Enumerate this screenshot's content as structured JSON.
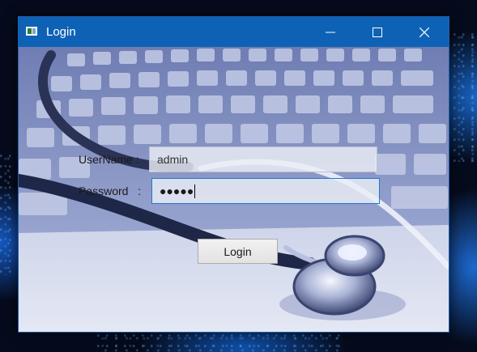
{
  "window": {
    "title": "Login",
    "icon": "app-icon",
    "controls": {
      "minimize_icon": "minimize-icon",
      "maximize_icon": "maximize-icon",
      "close_icon": "close-icon"
    },
    "titlebar_color": "#0e62b5"
  },
  "form": {
    "username_label": "UserName :",
    "username_value": "admin",
    "password_label": "Password   :",
    "password_value": "●●●●●",
    "login_label": "Login",
    "focus_color": "#1f78d1"
  },
  "background": {
    "subject": "keyboard-stethoscope-photo"
  }
}
